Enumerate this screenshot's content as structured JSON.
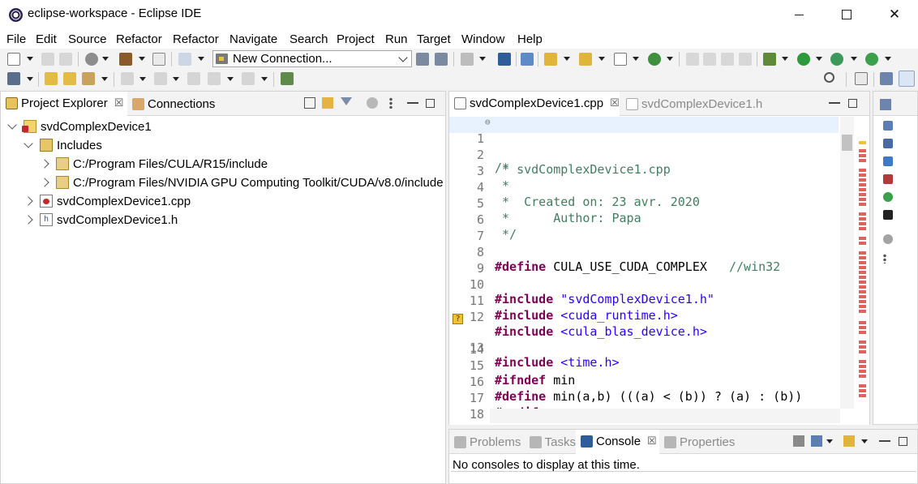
{
  "window": {
    "title": "eclipse-workspace - Eclipse IDE",
    "minimize_glyph": "—",
    "maximize_glyph": "☐",
    "close_glyph": "✕"
  },
  "menubar": {
    "items": [
      "File",
      "Edit",
      "Source",
      "Refactor",
      "Refactor",
      "Navigate",
      "Search",
      "Project",
      "Run",
      "Target",
      "Window",
      "Help"
    ]
  },
  "toolbar": {
    "connection_combo_value": "New Connection..."
  },
  "project_explorer": {
    "tabs": [
      {
        "label": "Project Explorer",
        "close": "☒"
      },
      {
        "label": "Connections"
      }
    ],
    "tree": [
      {
        "label": "svdComplexDevice1",
        "icon": "c-project-icon",
        "expanded": true
      },
      {
        "label": "Includes",
        "icon": "includes-icon",
        "expanded": true
      },
      {
        "label": "C:/Program Files/CULA/R15/include",
        "icon": "include-folder-icon",
        "expanded": false
      },
      {
        "label": "C:/Program Files/NVIDIA GPU Computing Toolkit/CUDA/v8.0/include",
        "icon": "include-folder-icon",
        "expanded": false
      },
      {
        "label": "svdComplexDevice1.cpp",
        "icon": "cpp-file-icon",
        "expanded": false
      },
      {
        "label": "svdComplexDevice1.h",
        "icon": "h-file-icon",
        "expanded": false
      }
    ]
  },
  "editor": {
    "tabs": [
      {
        "label": "svdComplexDevice1.cpp",
        "close": "☒",
        "active": true
      },
      {
        "label": "svdComplexDevice1.h",
        "active": false
      }
    ],
    "lines": [
      {
        "n": "1",
        "text": "/*"
      },
      {
        "n": "2",
        "text": " * svdComplexDevice1.cpp"
      },
      {
        "n": "3",
        "text": " *"
      },
      {
        "n": "4",
        "text": " *  Created on: 23 avr. 2020"
      },
      {
        "n": "5",
        "text": " *      Author: Papa"
      },
      {
        "n": "6",
        "text": " */"
      },
      {
        "n": "7",
        "text": ""
      },
      {
        "n": "8",
        "kw": "#define",
        "rest": " CULA_USE_CUDA_COMPLEX",
        "comment": "   //win32"
      },
      {
        "n": "9",
        "text": ""
      },
      {
        "n": "10",
        "kw": "#include",
        "str": " \"svdComplexDevice1.h\""
      },
      {
        "n": "11",
        "kw": "#include",
        "str": " <cuda_runtime.h>"
      },
      {
        "n": "12",
        "kw": "#include",
        "str": " <cula_blas_device.h>"
      },
      {
        "n": "13",
        "kw": "#include",
        "str": " <time.h>"
      },
      {
        "n": "14",
        "text": ""
      },
      {
        "n": "15",
        "kw": "#ifndef",
        "rest": " min"
      },
      {
        "n": "16",
        "kw": "#define",
        "rest": " min(a,b) (((a) < (b)) ? (a) : (b))"
      },
      {
        "n": "17",
        "kw": "#endif"
      },
      {
        "n": "18",
        "text": ""
      }
    ],
    "fold_glyph": "⊖",
    "warning_glyph": "?"
  },
  "bottom_panel": {
    "tabs": [
      {
        "label": "Problems"
      },
      {
        "label": "Tasks"
      },
      {
        "label": "Console",
        "close": "☒",
        "active": true
      },
      {
        "label": "Properties"
      }
    ],
    "console_message": "No consoles to display at this time."
  },
  "colors": {
    "keyword": "#7f0055",
    "comment": "#3f7f5f",
    "string": "#2a00ff",
    "current_line": "#e8f2fe"
  }
}
